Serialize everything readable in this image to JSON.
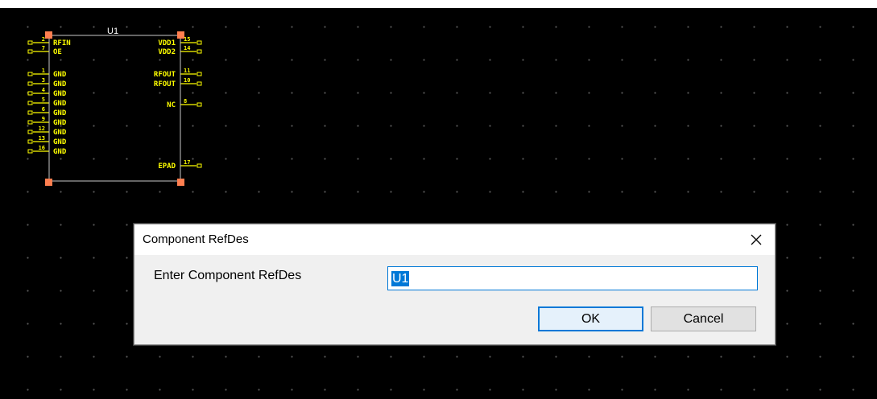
{
  "component": {
    "refdes": "U1",
    "left_pins": [
      {
        "num": "2",
        "name": "RFIN"
      },
      {
        "num": "7",
        "name": "OE"
      },
      {
        "num": "1",
        "name": "GND"
      },
      {
        "num": "3",
        "name": "GND"
      },
      {
        "num": "4",
        "name": "GND"
      },
      {
        "num": "5",
        "name": "GND"
      },
      {
        "num": "6",
        "name": "GND"
      },
      {
        "num": "9",
        "name": "GND"
      },
      {
        "num": "12",
        "name": "GND"
      },
      {
        "num": "13",
        "name": "GND"
      },
      {
        "num": "16",
        "name": "GND"
      }
    ],
    "right_pins": [
      {
        "num": "15",
        "name": "VDD1"
      },
      {
        "num": "14",
        "name": "VDD2"
      },
      {
        "num": "11",
        "name": "RFOUT"
      },
      {
        "num": "10",
        "name": "RFOUT"
      },
      {
        "num": "8",
        "name": "NC"
      },
      {
        "num": "17",
        "name": "EPAD"
      }
    ]
  },
  "dialog": {
    "title": "Component RefDes",
    "prompt": "Enter Component RefDes",
    "input_value": "U1",
    "ok_label": "OK",
    "cancel_label": "Cancel"
  },
  "colors": {
    "canvas_background": "#000000",
    "pin_text": "#ffff00",
    "component_outline": "#c8c8c8",
    "pin_handle": "#ff7f50",
    "accent": "#0078d7"
  },
  "icons": {
    "close": "close-icon"
  }
}
